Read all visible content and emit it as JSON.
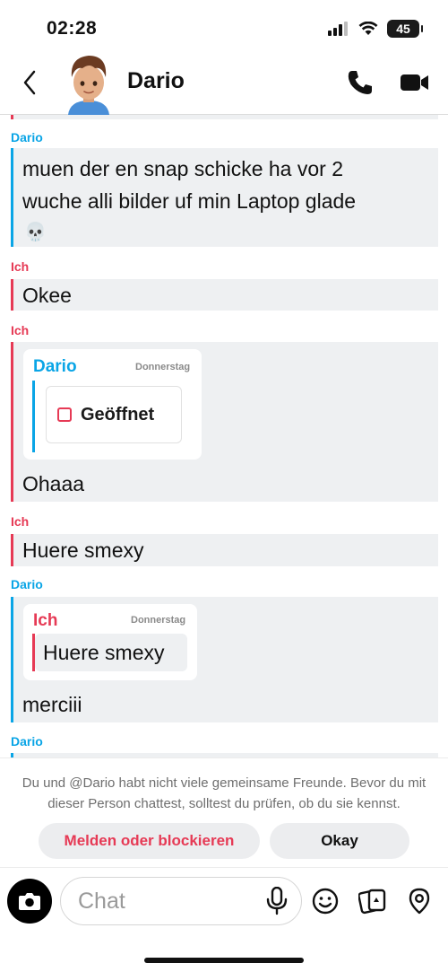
{
  "status_bar": {
    "time": "02:28",
    "battery": "45"
  },
  "header": {
    "name": "Dario",
    "icons": {
      "back": "chevron-left-icon",
      "call": "phone-icon",
      "video": "video-icon"
    }
  },
  "messages": [
    {
      "sender": "Dario",
      "text_line1": "muen der en snap schicke ha vor 2",
      "text_line2": "wuche alli bilder uf min Laptop glade",
      "emoji": "💀"
    },
    {
      "sender": "Ich",
      "text": "Okee"
    },
    {
      "sender": "Ich",
      "quote": {
        "name": "Dario",
        "date": "Donnerstag",
        "snap_label": "Geöffnet"
      },
      "text": "Ohaaa"
    },
    {
      "sender": "Ich",
      "text": "Huere smexy"
    },
    {
      "sender": "Dario",
      "quote": {
        "name": "Ich",
        "date": "Donnerstag",
        "text": "Huere smexy"
      },
      "text": "merciii"
    },
    {
      "sender": "Dario"
    }
  ],
  "notice": {
    "text": "Du und @Dario habt nicht viele gemeinsame Freunde. Bevor du mit dieser Person chattest, solltest du prüfen, ob du sie kennst.",
    "report_button": "Melden oder blockieren",
    "okay_button": "Okay"
  },
  "input": {
    "placeholder": "Chat"
  },
  "colors": {
    "dario": "#0aa5e6",
    "ich": "#e63a55",
    "bubble": "#eef0f2"
  }
}
